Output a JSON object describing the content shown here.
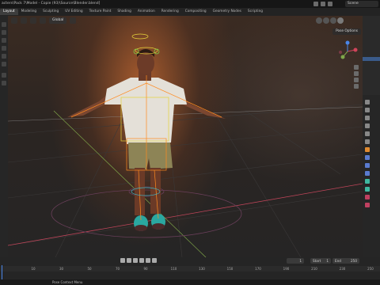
{
  "window": {
    "title": "acters\\Pack 7\\Model - Copie (93)\\Source\\Blender.blend]",
    "scene_label": "Scene"
  },
  "workspace_tabs": [
    {
      "label": "Layout",
      "active": true
    },
    {
      "label": "Modeling",
      "active": false
    },
    {
      "label": "Sculpting",
      "active": false
    },
    {
      "label": "UV Editing",
      "active": false
    },
    {
      "label": "Texture Paint",
      "active": false
    },
    {
      "label": "Shading",
      "active": false
    },
    {
      "label": "Animation",
      "active": false
    },
    {
      "label": "Rendering",
      "active": false
    },
    {
      "label": "Compositing",
      "active": false
    },
    {
      "label": "Geometry Nodes",
      "active": false
    },
    {
      "label": "Scripting",
      "active": false
    }
  ],
  "viewport": {
    "orientation_label": "Global",
    "pose_options_label": "Pose Options",
    "gizmo_axes": [
      "X",
      "Y",
      "Z"
    ]
  },
  "timeline": {
    "current_frame": "1",
    "start_label": "Start",
    "start_value": "1",
    "end_label": "End",
    "end_value": "250",
    "ruler_ticks": [
      "0",
      "20",
      "40",
      "60",
      "80",
      "100",
      "120",
      "140",
      "160",
      "180",
      "200",
      "220",
      "240"
    ],
    "visible_tick_labels": [
      "10",
      "30",
      "50",
      "70",
      "90",
      "110",
      "130",
      "150",
      "170",
      "190",
      "210",
      "230",
      "250"
    ]
  },
  "statusbar": {
    "menu_label": "Pose Context Menu"
  },
  "colors": {
    "accent_blue": "#4a86e8",
    "armature_orange": "#ff8a1f",
    "armature_yellow": "#e5d23a",
    "x_axis_red": "#c0455a",
    "y_axis_green": "#7fa64a"
  },
  "icons": {
    "gizmo": "navigation-gizmo-icon",
    "shading": "viewport-shading-icons",
    "playback": "playback-controls-icons"
  }
}
